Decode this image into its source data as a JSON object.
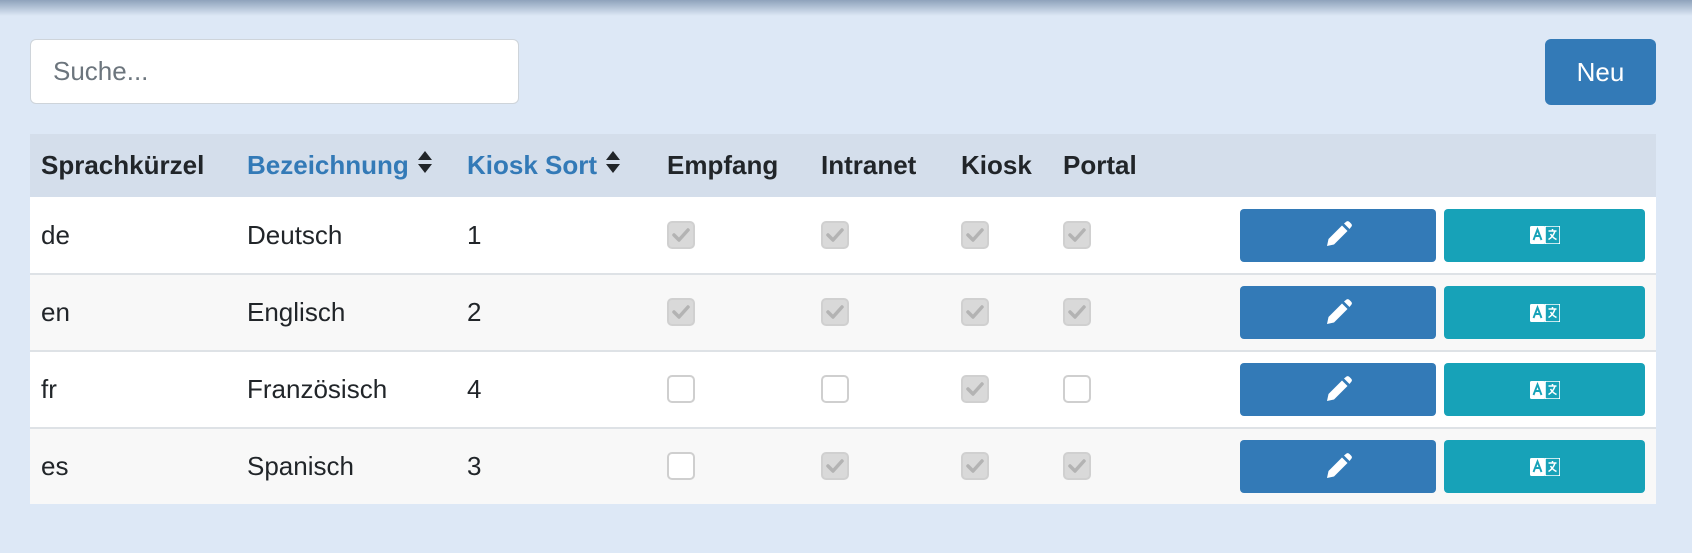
{
  "search": {
    "placeholder": "Suche..."
  },
  "toolbar": {
    "new_label": "Neu"
  },
  "table": {
    "columns": [
      {
        "key": "code",
        "label": "Sprachkürzel",
        "sortable": false
      },
      {
        "key": "name",
        "label": "Bezeichnung",
        "sortable": true
      },
      {
        "key": "kiosk_sort",
        "label": "Kiosk Sort",
        "sortable": true
      },
      {
        "key": "empfang",
        "label": "Empfang",
        "sortable": false
      },
      {
        "key": "intranet",
        "label": "Intranet",
        "sortable": false
      },
      {
        "key": "kiosk",
        "label": "Kiosk",
        "sortable": false
      },
      {
        "key": "portal",
        "label": "Portal",
        "sortable": false
      }
    ],
    "rows": [
      {
        "code": "de",
        "name": "Deutsch",
        "kiosk_sort": "1",
        "empfang": true,
        "intranet": true,
        "kiosk": true,
        "portal": true
      },
      {
        "code": "en",
        "name": "Englisch",
        "kiosk_sort": "2",
        "empfang": true,
        "intranet": true,
        "kiosk": true,
        "portal": true
      },
      {
        "code": "fr",
        "name": "Französisch",
        "kiosk_sort": "4",
        "empfang": false,
        "intranet": false,
        "kiosk": true,
        "portal": false
      },
      {
        "code": "es",
        "name": "Spanisch",
        "kiosk_sort": "3",
        "empfang": false,
        "intranet": true,
        "kiosk": true,
        "portal": true
      }
    ],
    "row_actions": [
      {
        "name": "edit-button",
        "icon": "pencil-icon",
        "color": "#337ab7"
      },
      {
        "name": "translate-button",
        "icon": "translate-icon",
        "color": "#17a2b8"
      }
    ]
  },
  "colors": {
    "background": "#dde8f6",
    "header_bg": "#d4deeb",
    "primary": "#337ab7",
    "info": "#17a2b8",
    "sort_header": "#337ab7"
  }
}
